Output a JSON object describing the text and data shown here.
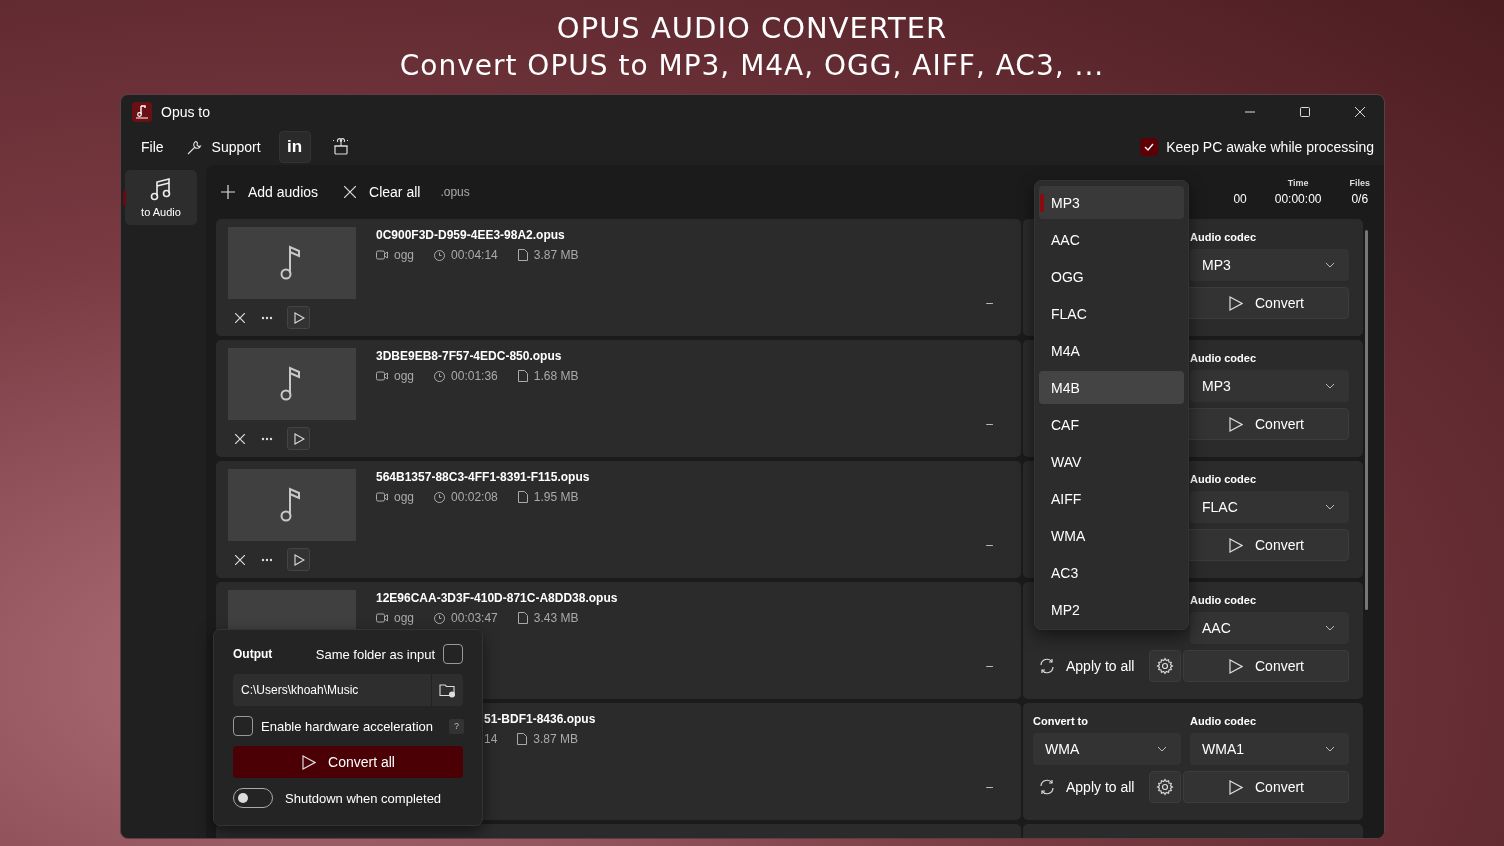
{
  "heading": {
    "title": "OPUS AUDIO CONVERTER",
    "subtitle": "Convert OPUS to MP3, M4A, OGG, AIFF, AC3, ..."
  },
  "window": {
    "title": "Opus to"
  },
  "menu": [
    {
      "kind": "text",
      "label": "File"
    },
    {
      "kind": "support",
      "label": "Support"
    },
    {
      "kind": "linkedin",
      "label": "in"
    },
    {
      "kind": "gift"
    }
  ],
  "keep_awake": {
    "label": "Keep PC awake while processing",
    "checked": true
  },
  "nav": [
    {
      "label": "to Audio",
      "selected": true
    }
  ],
  "toolbar": {
    "add": "Add audios",
    "clear": "Clear all",
    "extension": ".opus"
  },
  "stats": [
    {
      "value": "00"
    },
    {
      "label": "Time",
      "value": "00:00:00"
    },
    {
      "label": "Files",
      "value": "0/6"
    }
  ],
  "rows": [
    {
      "name": "0C900F3D-D959-4EE3-98A2.opus",
      "format": "ogg",
      "duration": "00:04:14",
      "size": "3.87 MB",
      "thumbnail": true,
      "controls": true,
      "status": "–",
      "codec_label": "Audio codec",
      "codec": "MP3",
      "convert": "Convert"
    },
    {
      "name": "3DBE9EB8-7F57-4EDC-850.opus",
      "format": "ogg",
      "duration": "00:01:36",
      "size": "1.68 MB",
      "thumbnail": true,
      "controls": true,
      "status": "–",
      "codec_label": "Audio codec",
      "codec": "MP3",
      "convert": "Convert"
    },
    {
      "name": "564B1357-88C3-4FF1-8391-F115.opus",
      "format": "ogg",
      "duration": "00:02:08",
      "size": "1.95 MB",
      "thumbnail": true,
      "controls": true,
      "status": "–",
      "codec_label": "Audio codec",
      "codec": "FLAC",
      "convert": "Convert"
    },
    {
      "name": "12E96CAA-3D3F-410D-871C-A8DD38.opus",
      "format": "ogg",
      "duration": "00:03:47",
      "size": "3.43 MB",
      "thumbnail": true,
      "controls": false,
      "status": "–",
      "codec_label": "Audio codec",
      "codec": "AAC",
      "apply": "Apply to all",
      "convert": "Convert"
    },
    {
      "name": "51-BDF1-8436.opus",
      "duration": "14",
      "size": "3.87 MB",
      "thumbnail": false,
      "status": "–",
      "convert_to_label": "Convert to",
      "convert_to": "WMA",
      "codec_label": "Audio codec",
      "codec": "WMA1",
      "apply": "Apply to all",
      "convert": "Convert"
    }
  ],
  "format_menu": [
    {
      "label": "MP3",
      "selected": true,
      "highlighted": true
    },
    {
      "label": "AAC",
      "selected": false,
      "highlighted": false
    },
    {
      "label": "OGG",
      "selected": false,
      "highlighted": false
    },
    {
      "label": "FLAC",
      "selected": false,
      "highlighted": false
    },
    {
      "label": "M4A",
      "selected": false,
      "highlighted": false
    },
    {
      "label": "M4B",
      "selected": false,
      "highlighted": true
    },
    {
      "label": "CAF",
      "selected": false,
      "highlighted": false
    },
    {
      "label": "WAV",
      "selected": false,
      "highlighted": false
    },
    {
      "label": "AIFF",
      "selected": false,
      "highlighted": false
    },
    {
      "label": "WMA",
      "selected": false,
      "highlighted": false
    },
    {
      "label": "AC3",
      "selected": false,
      "highlighted": false
    },
    {
      "label": "MP2",
      "selected": false,
      "highlighted": false
    }
  ],
  "output_panel": {
    "label": "Output",
    "same_folder": {
      "label": "Same folder as input",
      "checked": false
    },
    "path": "C:\\Users\\khoah\\Music",
    "hardware": {
      "label": "Enable hardware acceleration",
      "checked": false,
      "help": "?"
    },
    "convert_all": "Convert all",
    "shutdown": {
      "label": "Shutdown when completed",
      "on": false
    }
  }
}
